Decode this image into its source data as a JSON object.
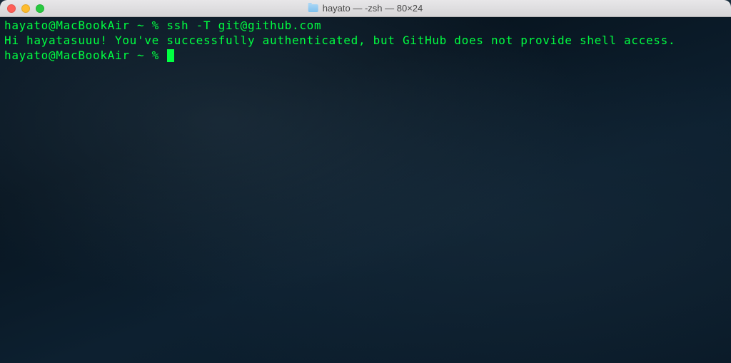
{
  "window": {
    "title": "hayato — -zsh — 80×24"
  },
  "terminal": {
    "prompt1": "hayato@MacBookAir ~ % ",
    "command1": "ssh -T git@github.com",
    "output1": "Hi hayatasuuu! You've successfully authenticated, but GitHub does not provide shell access.",
    "prompt2": "hayato@MacBookAir ~ % "
  }
}
